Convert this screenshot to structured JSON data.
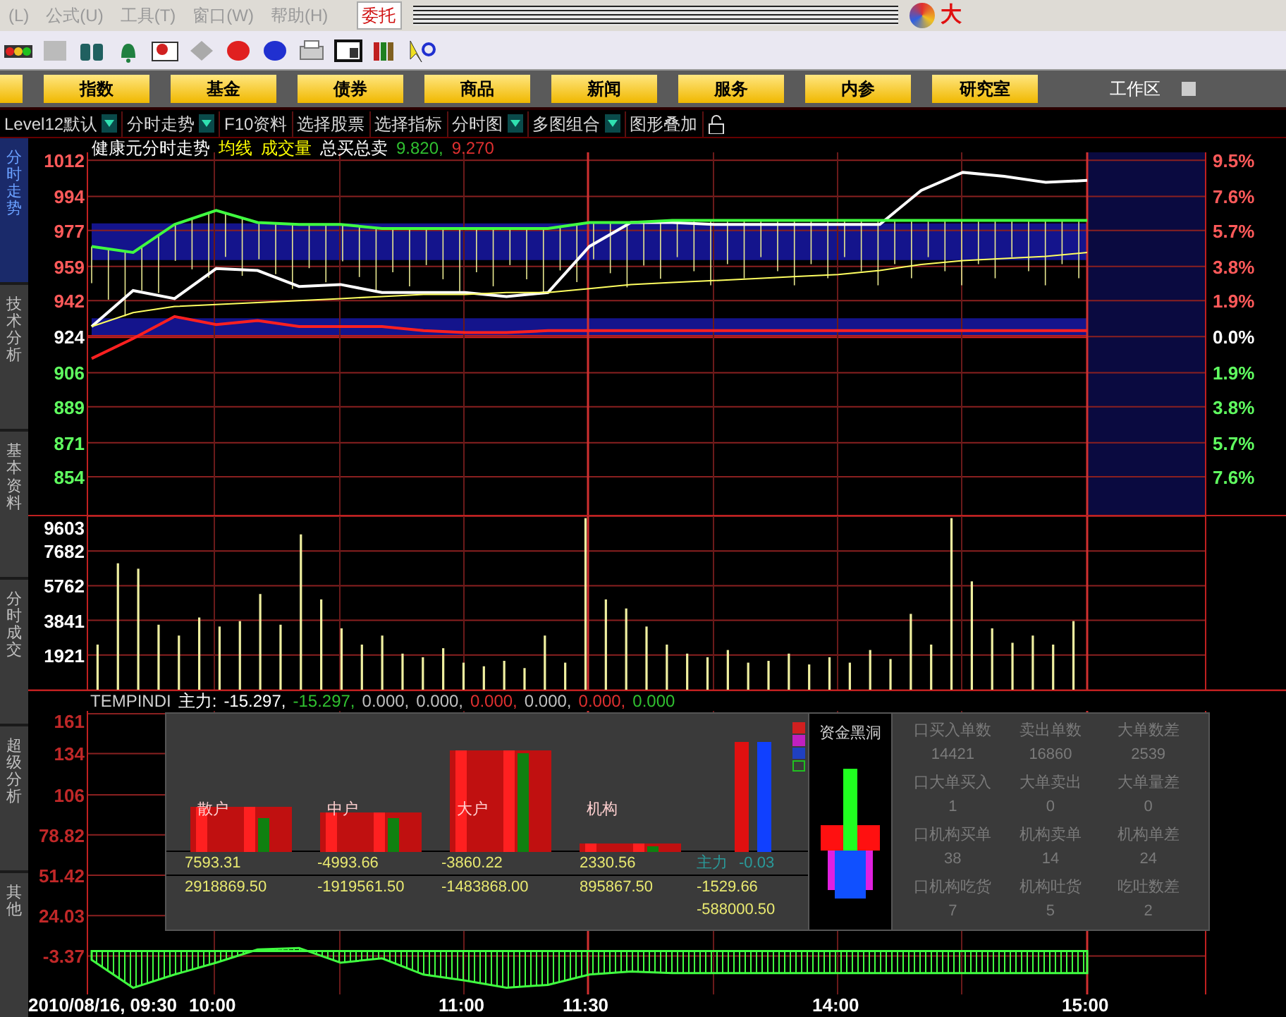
{
  "menu": [
    {
      "label": "(L)"
    },
    {
      "label": "公式(U)"
    },
    {
      "label": "工具(T)"
    },
    {
      "label": "窗口(W)"
    },
    {
      "label": "帮助(H)"
    }
  ],
  "trade_tab": {
    "label": "委托"
  },
  "logo": {
    "text": "大"
  },
  "nav_buttons": [
    "指数",
    "基金",
    "债券",
    "商品",
    "新闻",
    "服务",
    "内参",
    "研究室"
  ],
  "workspace": {
    "label": "工作区"
  },
  "view_toolbar": [
    {
      "label": "Level12默认",
      "dropdown": true
    },
    {
      "label": "分时走势",
      "dropdown": true
    },
    {
      "label": "F10资料",
      "dropdown": false
    },
    {
      "label": "选择股票",
      "dropdown": false
    },
    {
      "label": "选择指标",
      "dropdown": false
    },
    {
      "label": "分时图",
      "dropdown": true
    },
    {
      "label": "多图组合",
      "dropdown": true
    },
    {
      "label": "图形叠加",
      "dropdown": false
    }
  ],
  "side_tabs": [
    {
      "label": "分时走势",
      "selected": true
    },
    {
      "label": "技术分析",
      "selected": false
    },
    {
      "label": "基本资料",
      "selected": false
    },
    {
      "label": "分时成交",
      "selected": false
    },
    {
      "label": "超级分析",
      "selected": false
    },
    {
      "label": "其他",
      "selected": false
    }
  ],
  "price_chart": {
    "title_items": [
      {
        "text": "健康元分时走势",
        "color": "#ffffff"
      },
      {
        "text": "均线",
        "color": "#ffff00"
      },
      {
        "text": "成交量",
        "color": "#ffff00"
      },
      {
        "text": "总买总卖",
        "color": "#ffffff"
      },
      {
        "text": "9.820,",
        "color": "#30c030"
      },
      {
        "text": "9.270",
        "color": "#e03030"
      }
    ],
    "left_axis": [
      {
        "label": "1012",
        "kind": "up"
      },
      {
        "label": "994",
        "kind": "up"
      },
      {
        "label": "977",
        "kind": "up"
      },
      {
        "label": "959",
        "kind": "up"
      },
      {
        "label": "942",
        "kind": "up"
      },
      {
        "label": "924",
        "kind": "flat"
      },
      {
        "label": "906",
        "kind": "down"
      },
      {
        "label": "889",
        "kind": "down"
      },
      {
        "label": "871",
        "kind": "down"
      },
      {
        "label": "854",
        "kind": "down"
      }
    ],
    "right_axis": [
      {
        "label": "9.5%",
        "kind": "up"
      },
      {
        "label": "7.6%",
        "kind": "up"
      },
      {
        "label": "5.7%",
        "kind": "up"
      },
      {
        "label": "3.8%",
        "kind": "up"
      },
      {
        "label": "1.9%",
        "kind": "up"
      },
      {
        "label": "0.0%",
        "kind": "flat"
      },
      {
        "label": "1.9%",
        "kind": "down"
      },
      {
        "label": "3.8%",
        "kind": "down"
      },
      {
        "label": "5.7%",
        "kind": "down"
      },
      {
        "label": "7.6%",
        "kind": "down"
      }
    ],
    "chart_data": {
      "type": "line",
      "grid": true,
      "yticks": [
        1012,
        994,
        977,
        959,
        942,
        924,
        906,
        889,
        871,
        854
      ],
      "ylim": [
        835,
        1016
      ],
      "series": [
        {
          "color": "#ffffff",
          "values": [
            929,
            947,
            943,
            958,
            957,
            949,
            950,
            946,
            946,
            946,
            944,
            946,
            969,
            981,
            981,
            980,
            980,
            980,
            980,
            980,
            997,
            1006,
            1004,
            1001,
            1002
          ]
        },
        {
          "color": "#ffff60",
          "values": [
            929,
            936,
            939,
            940,
            941,
            942,
            943,
            944,
            945,
            945,
            946,
            946,
            948,
            950,
            951,
            952,
            953,
            954,
            955,
            957,
            960,
            962,
            963,
            964,
            966
          ]
        },
        {
          "color": "#40ff40",
          "values": [
            969,
            966,
            980,
            987,
            981,
            980,
            980,
            978,
            978,
            978,
            978,
            978,
            981,
            981,
            982,
            982,
            982,
            982,
            982,
            982,
            982,
            982,
            982,
            982,
            982
          ]
        },
        {
          "color": "#ff2020",
          "values": [
            913,
            923,
            934,
            930,
            932,
            929,
            929,
            929,
            927,
            926,
            926,
            927,
            927,
            927,
            927,
            927,
            927,
            927,
            927,
            927,
            927,
            927,
            927,
            927,
            927
          ]
        }
      ]
    }
  },
  "volume_chart": {
    "chart_data": {
      "type": "bar",
      "grid": true,
      "yticks": [
        9603,
        7682,
        5762,
        3841,
        1921
      ],
      "ylim": [
        0,
        9603
      ],
      "values": [
        2500,
        7000,
        6700,
        3600,
        3000,
        4000,
        3500,
        3800,
        5300,
        3600,
        8600,
        5000,
        3400,
        2500,
        3000,
        2000,
        1800,
        2300,
        1500,
        1300,
        1600,
        1200,
        3000,
        1500,
        9500,
        5000,
        4500,
        3500,
        2500,
        2000,
        1800,
        2200,
        1500,
        1600,
        2000,
        1400,
        1800,
        1500,
        2200,
        1700,
        4200,
        2500,
        9500,
        6000,
        3400,
        2600,
        3000,
        2500,
        3800,
        null,
        null,
        null,
        null,
        null,
        null
      ]
    }
  },
  "indicator": {
    "name": "TEMPINDI",
    "label": "主力:",
    "readings": [
      {
        "text": "-15.297,",
        "color": "#ffffff"
      },
      {
        "text": "-15.297,",
        "color": "#30c030"
      },
      {
        "text": "0.000,",
        "color": "#c0c0c0"
      },
      {
        "text": "0.000,",
        "color": "#c0c0c0"
      },
      {
        "text": "0.000,",
        "color": "#e03030"
      },
      {
        "text": "0.000,",
        "color": "#c0c0c0"
      },
      {
        "text": "0.000,",
        "color": "#e03030"
      },
      {
        "text": "0.000",
        "color": "#30c030"
      }
    ],
    "chart_data": {
      "type": "area",
      "grid": true,
      "yticks": [
        161,
        134,
        106,
        78.82,
        51.42,
        24.03,
        -3.37
      ],
      "ylim": [
        -29.5,
        161
      ],
      "series": [
        {
          "color": "#40ff40",
          "values": [
            -6,
            -25,
            -16,
            -8,
            1,
            2,
            -8,
            -5,
            -16,
            -20,
            -25,
            -23,
            -16,
            -14,
            -15,
            -15,
            -15,
            -15,
            -15,
            -15,
            -15,
            -15,
            -15,
            -15,
            -15
          ]
        }
      ]
    }
  },
  "fund_panel": {
    "groups": [
      {
        "label": "散户",
        "row1": "7593.31",
        "row2": "2918869.50"
      },
      {
        "label": "中户",
        "row1": "-4993.66",
        "row2": "-1919561.50"
      },
      {
        "label": "大户",
        "row1": "-3860.22",
        "row2": "-1483868.00"
      },
      {
        "label": "机构",
        "row1": "2330.56",
        "row2": "895867.50"
      }
    ],
    "main_force": {
      "label": "主力",
      "value": "-0.03"
    },
    "extra_values": [
      "-1529.66",
      "-588000.50"
    ],
    "black_hole": {
      "title": "资金黑洞"
    },
    "stats": [
      {
        "label": "口买入单数",
        "value": "14421"
      },
      {
        "label": "卖出单数",
        "value": "16860"
      },
      {
        "label": "大单数差",
        "value": "2539"
      },
      {
        "label": "口大单买入",
        "value": "1"
      },
      {
        "label": "大单卖出",
        "value": "0"
      },
      {
        "label": "大单量差",
        "value": "0"
      },
      {
        "label": "口机构买单",
        "value": "38"
      },
      {
        "label": "机构卖单",
        "value": "14"
      },
      {
        "label": "机构单差",
        "value": "24"
      },
      {
        "label": "口机构吃货",
        "value": "7"
      },
      {
        "label": "机构吐货",
        "value": "5"
      },
      {
        "label": "吃吐数差",
        "value": "2"
      }
    ]
  },
  "time_axis": [
    "2010/08/16, 09:30",
    "10:00",
    "11:00",
    "11:30",
    "14:00",
    "15:00"
  ]
}
